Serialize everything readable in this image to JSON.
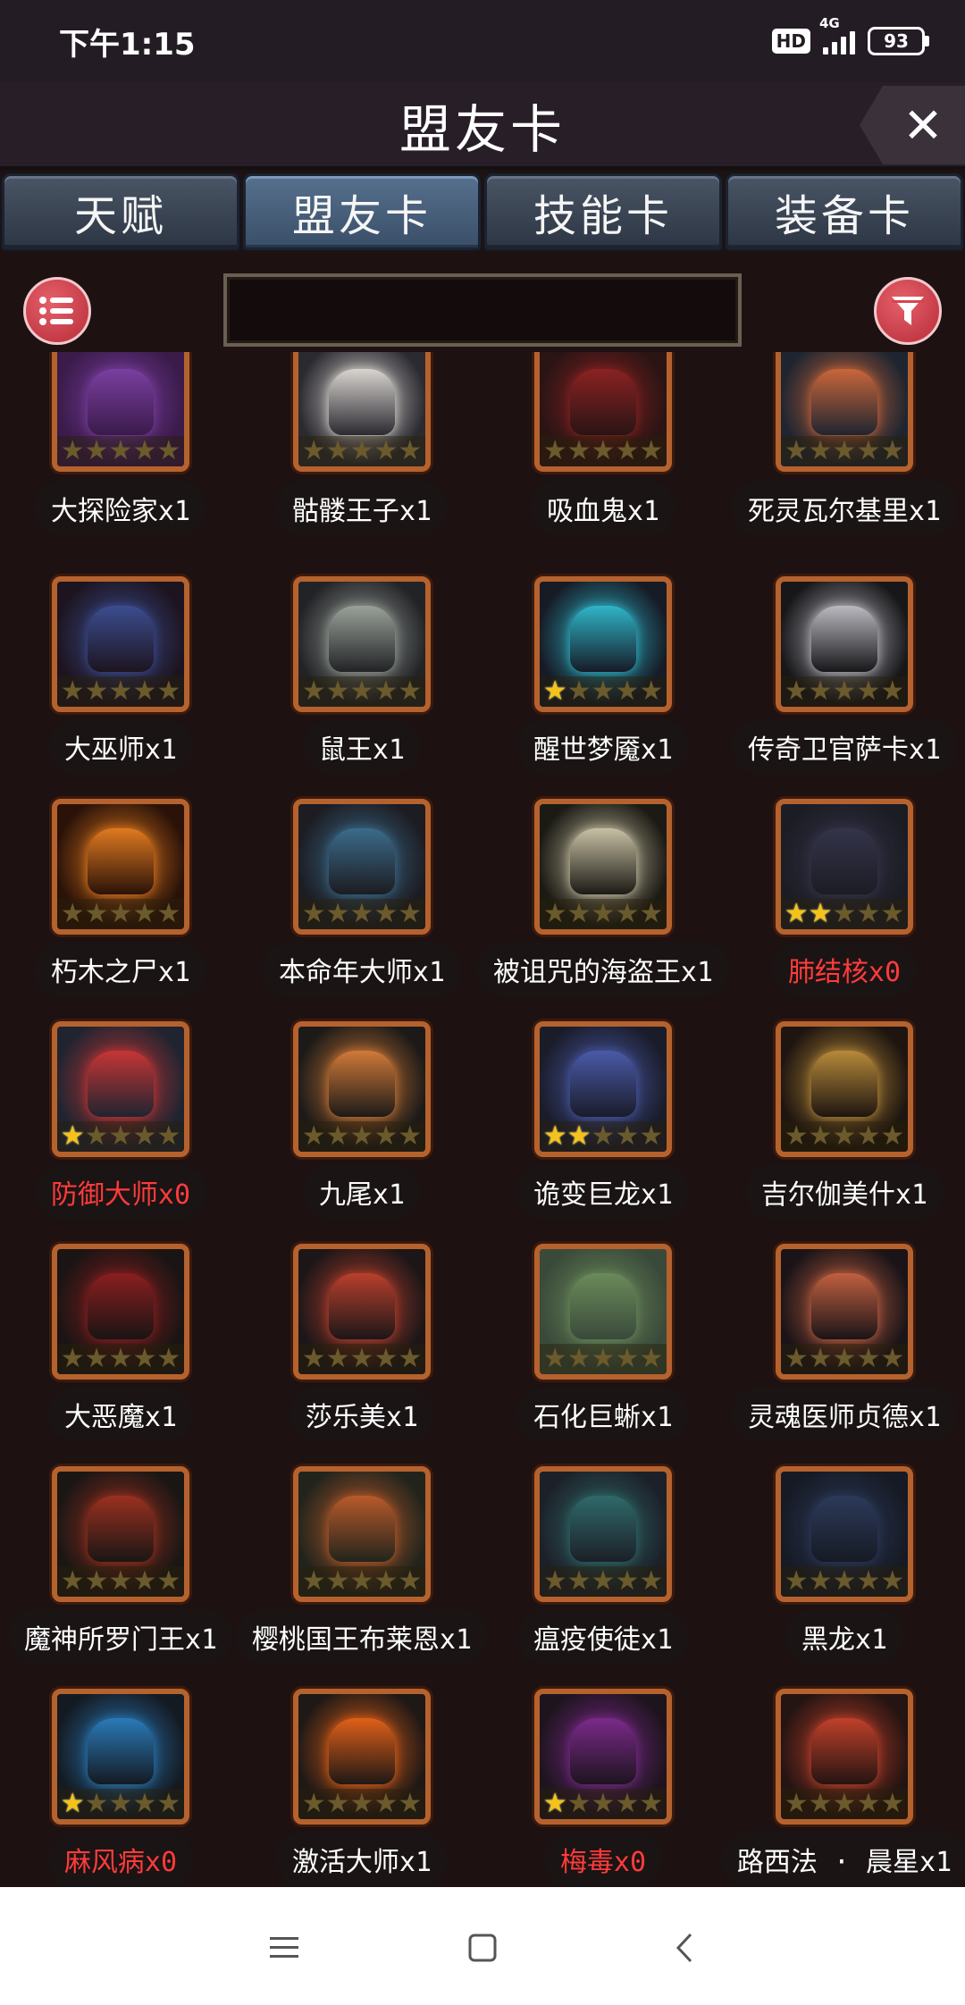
{
  "status": {
    "time": "下午1:15",
    "hd": "HD",
    "network": "4G",
    "battery": "93"
  },
  "header": {
    "title": "盟友卡",
    "close_icon": "close-icon"
  },
  "tabs": [
    {
      "label": "天赋",
      "active": false
    },
    {
      "label": "盟友卡",
      "active": true
    },
    {
      "label": "技能卡",
      "active": false
    },
    {
      "label": "装备卡",
      "active": false
    }
  ],
  "toolbar": {
    "menu_icon": "list-icon",
    "filter_icon": "filter-icon",
    "search_value": "",
    "accent_color": "#d9434f"
  },
  "cards": [
    {
      "name": "大探险家x1",
      "stars": 0,
      "owned": true,
      "bg": "#3a1b4a",
      "fg": "#7a3fa0"
    },
    {
      "name": "骷髅王子x1",
      "stars": 0,
      "owned": true,
      "bg": "#2b2a30",
      "fg": "#d8d4cf"
    },
    {
      "name": "吸血鬼x1",
      "stars": 0,
      "owned": true,
      "bg": "#2a1414",
      "fg": "#8a2222"
    },
    {
      "name": "死灵瓦尔基里x1",
      "stars": 0,
      "owned": true,
      "bg": "#1f2530",
      "fg": "#c9663a"
    },
    {
      "name": "大巫师x1",
      "stars": 0,
      "owned": true,
      "bg": "#1d1420",
      "fg": "#3b4d8f"
    },
    {
      "name": "鼠王x1",
      "stars": 0,
      "owned": true,
      "bg": "#222326",
      "fg": "#9aa19a"
    },
    {
      "name": "醒世梦魇x1",
      "stars": 1,
      "owned": true,
      "bg": "#161b26",
      "fg": "#2fb5c8"
    },
    {
      "name": "传奇卫官萨卡x1",
      "stars": 0,
      "owned": true,
      "bg": "#17171a",
      "fg": "#b9b9bf"
    },
    {
      "name": "朽木之尸x1",
      "stars": 0,
      "owned": true,
      "bg": "#2a1208",
      "fg": "#e07a20"
    },
    {
      "name": "本命年大师x1",
      "stars": 0,
      "owned": true,
      "bg": "#1c1c22",
      "fg": "#3b6b8a"
    },
    {
      "name": "被诅咒的海盗王x1",
      "stars": 0,
      "owned": true,
      "bg": "#1b1a14",
      "fg": "#c8c0a4"
    },
    {
      "name": "肺结核x0",
      "stars": 2,
      "owned": false,
      "bg": "#1c1c24",
      "fg": "#34344a"
    },
    {
      "name": "防御大师x0",
      "stars": 1,
      "owned": false,
      "bg": "#202430",
      "fg": "#c63535"
    },
    {
      "name": "九尾x1",
      "stars": 0,
      "owned": true,
      "bg": "#1c1a18",
      "fg": "#d07a38"
    },
    {
      "name": "诡变巨龙x1",
      "stars": 2,
      "owned": true,
      "bg": "#1a1c2a",
      "fg": "#4a5aa8"
    },
    {
      "name": "吉尔伽美什x1",
      "stars": 0,
      "owned": true,
      "bg": "#1e1510",
      "fg": "#b78a3a"
    },
    {
      "name": "大恶魔x1",
      "stars": 0,
      "owned": true,
      "bg": "#1a1414",
      "fg": "#8a1f1f"
    },
    {
      "name": "莎乐美x1",
      "stars": 0,
      "owned": true,
      "bg": "#1c1618",
      "fg": "#b8402c"
    },
    {
      "name": "石化巨蜥x1",
      "stars": 0,
      "owned": true,
      "bg": "#3a4a3a",
      "fg": "#6a8a5a"
    },
    {
      "name": "灵魂医师贞德x1",
      "stars": 0,
      "owned": true,
      "bg": "#1a1418",
      "fg": "#c06040"
    },
    {
      "name": "魔神所罗门王x1",
      "stars": 0,
      "owned": true,
      "bg": "#1a1614",
      "fg": "#9a3020"
    },
    {
      "name": "樱桃国王布莱恩x1",
      "stars": 0,
      "owned": true,
      "bg": "#22241c",
      "fg": "#b85a2a"
    },
    {
      "name": "瘟疫使徒x1",
      "stars": 0,
      "owned": true,
      "bg": "#1c2028",
      "fg": "#2f6a6a"
    },
    {
      "name": "黑龙x1",
      "stars": 0,
      "owned": true,
      "bg": "#161a24",
      "fg": "#2c3a5a"
    },
    {
      "name": "麻风病x0",
      "stars": 1,
      "owned": false,
      "bg": "#141a22",
      "fg": "#2a7ab8"
    },
    {
      "name": "激活大师x1",
      "stars": 0,
      "owned": true,
      "bg": "#1e1816",
      "fg": "#e06018"
    },
    {
      "name": "梅毒x0",
      "stars": 1,
      "owned": false,
      "bg": "#1e141e",
      "fg": "#7a2a8a"
    },
    {
      "name": "路西法 · 晨星x1",
      "stars": 0,
      "owned": true,
      "bg": "#241412",
      "fg": "#c0402a"
    }
  ],
  "nav": {
    "menu_icon": "hamburger-icon",
    "home_icon": "home-square-icon",
    "back_icon": "back-chevron-icon"
  }
}
